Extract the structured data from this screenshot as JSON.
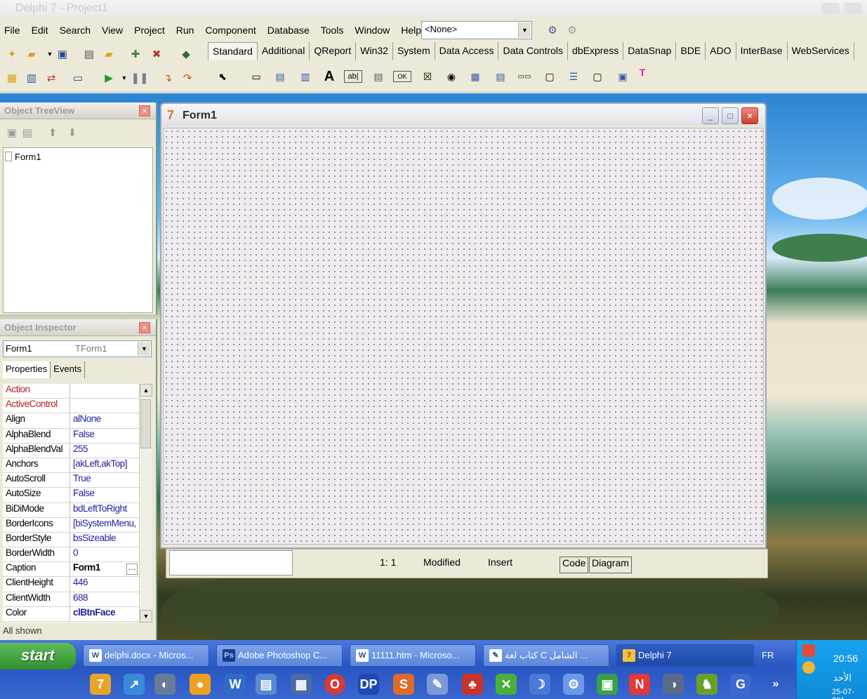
{
  "window_title": "Delphi 7 - Project1",
  "menu": [
    "File",
    "Edit",
    "Search",
    "View",
    "Project",
    "Run",
    "Component",
    "Database",
    "Tools",
    "Window",
    "Help"
  ],
  "config_combo": "<None>",
  "palette_tabs": [
    "Standard",
    "Additional",
    "QReport",
    "Win32",
    "System",
    "Data Access",
    "Data Controls",
    "dbExpress",
    "DataSnap",
    "BDE",
    "ADO",
    "InterBase",
    "WebServices"
  ],
  "treeview": {
    "title": "Object TreeView",
    "node": "Form1"
  },
  "inspector": {
    "title": "Object Inspector",
    "object_name": "Form1",
    "object_type": "TForm1",
    "tabs": [
      "Properties",
      "Events"
    ],
    "rows": [
      {
        "name": "Action",
        "value": ""
      },
      {
        "name": "ActiveControl",
        "value": ""
      },
      {
        "name": "Align",
        "value": "alNone"
      },
      {
        "name": "AlphaBlend",
        "value": "False"
      },
      {
        "name": "AlphaBlendVal",
        "value": "255"
      },
      {
        "name": "Anchors",
        "value": "[akLeft,akTop]"
      },
      {
        "name": "AutoScroll",
        "value": "True"
      },
      {
        "name": "AutoSize",
        "value": "False"
      },
      {
        "name": "BiDiMode",
        "value": "bdLeftToRight"
      },
      {
        "name": "BorderIcons",
        "value": "[biSystemMenu,"
      },
      {
        "name": "BorderStyle",
        "value": "bsSizeable"
      },
      {
        "name": "BorderWidth",
        "value": "0"
      },
      {
        "name": "Caption",
        "value": "Form1"
      },
      {
        "name": "ClientHeight",
        "value": "446"
      },
      {
        "name": "ClientWidth",
        "value": "688"
      },
      {
        "name": "Color",
        "value": "clBtnFace"
      }
    ],
    "status": "All shown"
  },
  "form": {
    "title": "Form1"
  },
  "editor_status": {
    "position": "1:  1",
    "modified": "Modified",
    "mode": "Insert",
    "tab_code": "Code",
    "tab_diagram": "Diagram"
  },
  "taskbar": {
    "start": "start",
    "items": [
      {
        "label": "delphi.docx - Micros...",
        "icon": "W"
      },
      {
        "label": "Adobe Photoshop C...",
        "icon": "Ps"
      },
      {
        "label": "11111.htm - Microso...",
        "icon": "W"
      },
      {
        "label": "كتاب لغة C الشامل ...",
        "icon": "✎"
      },
      {
        "label": "Delphi 7",
        "icon": "7"
      }
    ],
    "lang": "FR",
    "clock": "20:56",
    "day": "الأحد",
    "date": "25-07-201"
  }
}
